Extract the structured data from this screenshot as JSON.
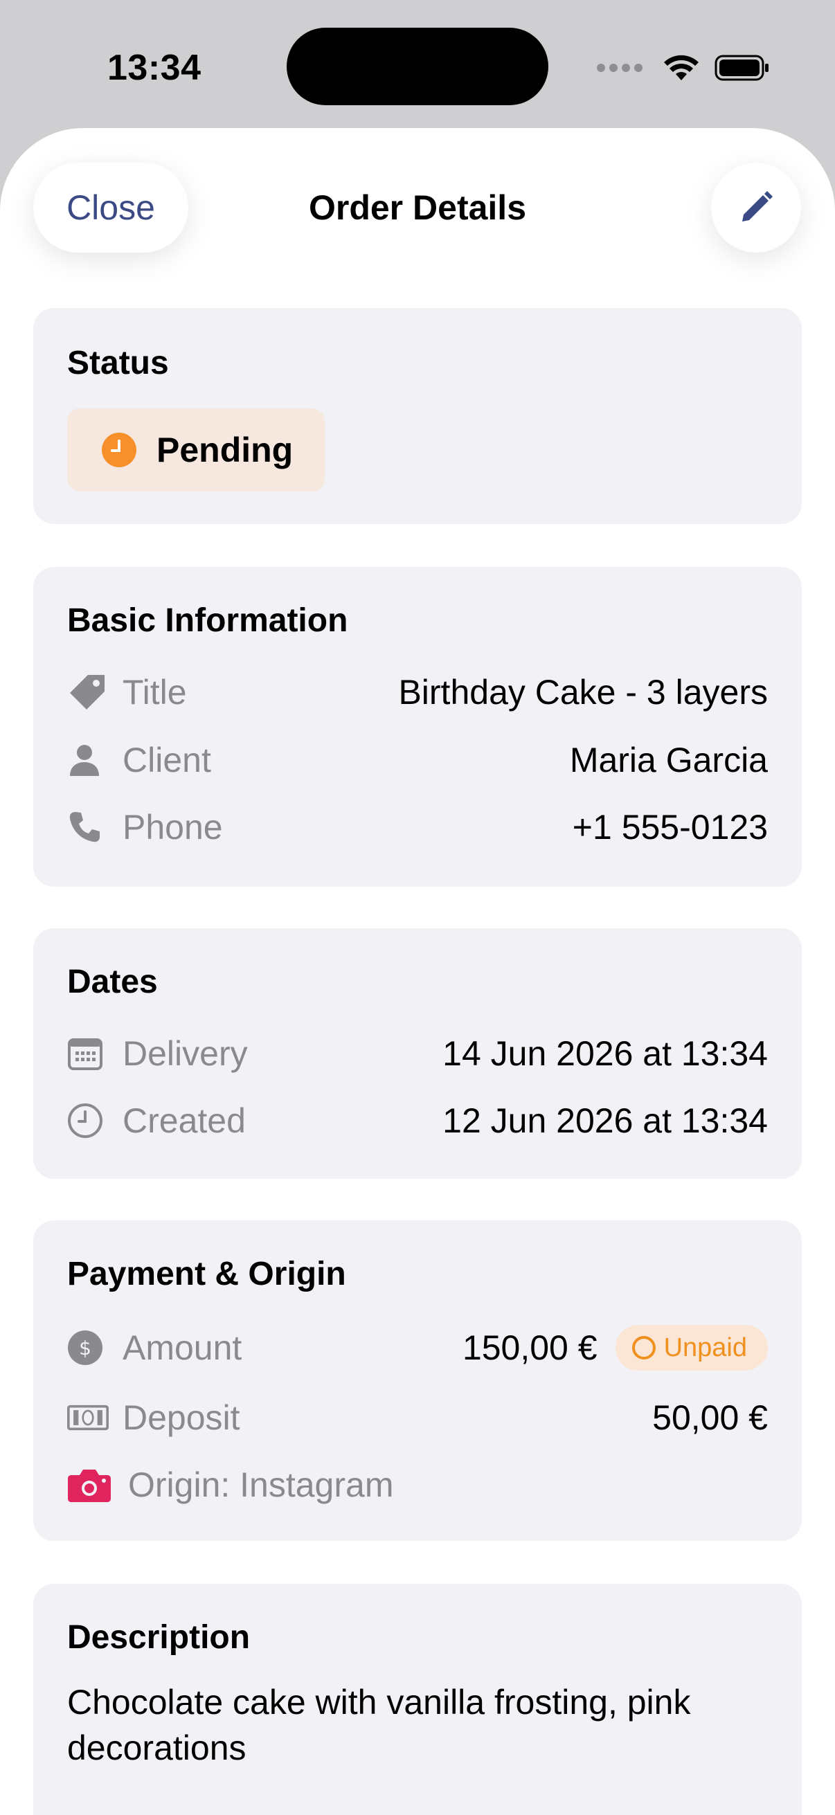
{
  "status_bar": {
    "time": "13:34"
  },
  "nav": {
    "close_label": "Close",
    "title": "Order Details",
    "edit_icon": "pencil-icon"
  },
  "status_section": {
    "title": "Status",
    "status": "Pending",
    "status_color": "#f7902b"
  },
  "basic_info": {
    "title": "Basic Information",
    "rows": [
      {
        "icon": "tag-icon",
        "label": "Title",
        "value": "Birthday Cake - 3 layers"
      },
      {
        "icon": "person-icon",
        "label": "Client",
        "value": "Maria Garcia"
      },
      {
        "icon": "phone-icon",
        "label": "Phone",
        "value": "+1 555-0123"
      }
    ]
  },
  "dates": {
    "title": "Dates",
    "rows": [
      {
        "icon": "calendar-icon",
        "label": "Delivery",
        "value": "14 Jun 2026 at 13:34"
      },
      {
        "icon": "clock-icon",
        "label": "Created",
        "value": "12 Jun 2026 at 13:34"
      }
    ]
  },
  "payment": {
    "title": "Payment & Origin",
    "amount_label": "Amount",
    "amount_value": "150,00 €",
    "payment_status": "Unpaid",
    "deposit_label": "Deposit",
    "deposit_value": "50,00 €",
    "origin_label": "Origin: Instagram",
    "origin_color": "#e0245e"
  },
  "description": {
    "title": "Description",
    "text": "Chocolate cake with vanilla frosting, pink decorations"
  },
  "colors": {
    "accent": "#3b4a84",
    "card_bg": "#f1f1f6",
    "secondary_text": "#8a8a8e",
    "warning": "#f0901f"
  }
}
